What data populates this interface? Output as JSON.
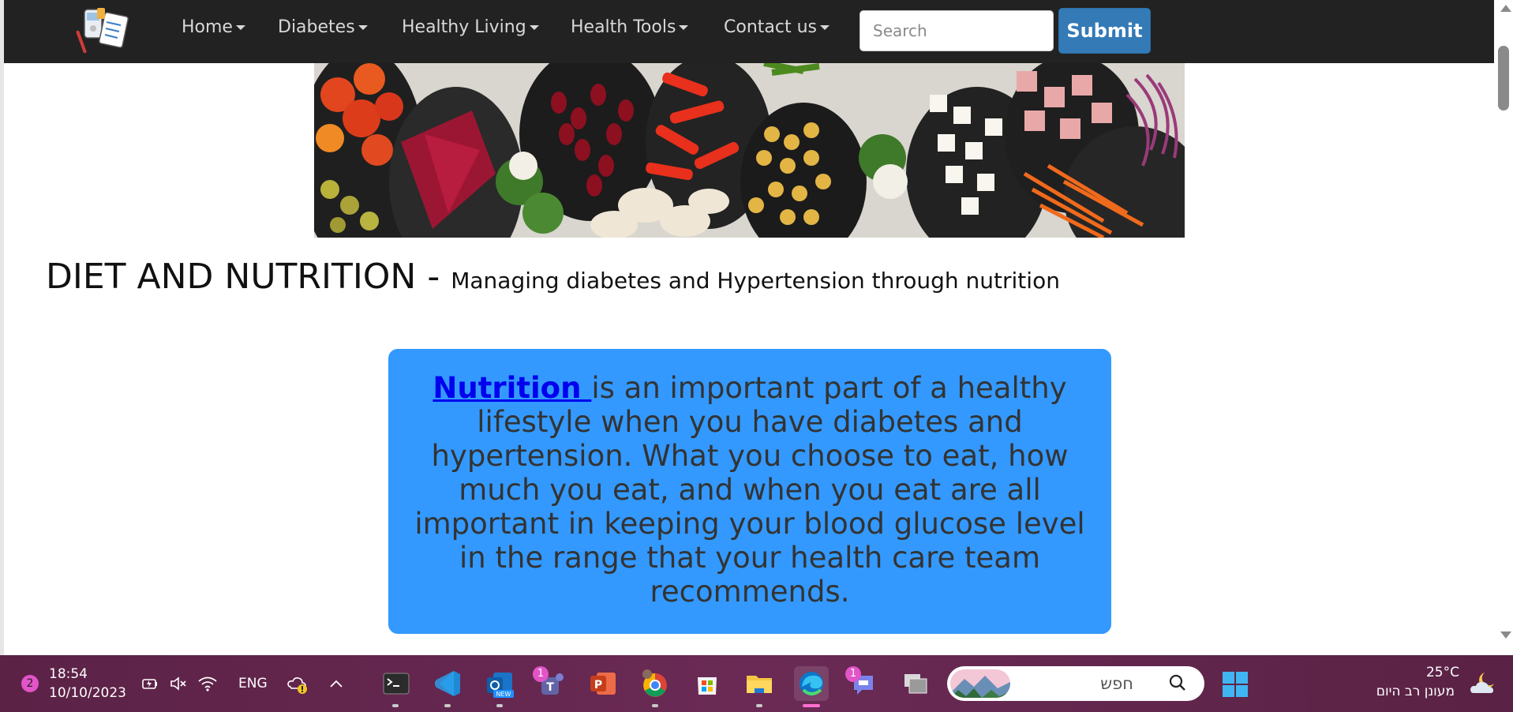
{
  "navbar": {
    "logo_icon": "diabetes-tools-logo-icon",
    "items": [
      {
        "label": "Home"
      },
      {
        "label": "Diabetes"
      },
      {
        "label": "Healthy Living"
      },
      {
        "label": "Health Tools"
      },
      {
        "label": "Contact us"
      }
    ],
    "search_placeholder": "Search",
    "submit_label": "Submit"
  },
  "banner": {
    "icon": "vegetables-banner-image"
  },
  "heading": {
    "title": "DIET AND NUTRITION",
    "separator": " - ",
    "subtitle": "Managing diabetes and Hypertension through nutrition"
  },
  "infobox": {
    "link_text": "Nutrition ",
    "body": " is an important part of a healthy lifestyle when you have diabetes and hypertension. What you choose to eat, how much you eat, and when you eat are all important in keeping your blood glucose level in the range that your health care team recommends.",
    "background": "#3399ff"
  },
  "taskbar": {
    "notification_count": "2",
    "time": "18:54",
    "date": "10/10/2023",
    "language": "ENG",
    "teams_badge": "1",
    "chat_badge": "1",
    "search_text": "חפש",
    "temperature": "25°C",
    "weather": "מעונן רב היום",
    "accent": "#e254c7"
  }
}
